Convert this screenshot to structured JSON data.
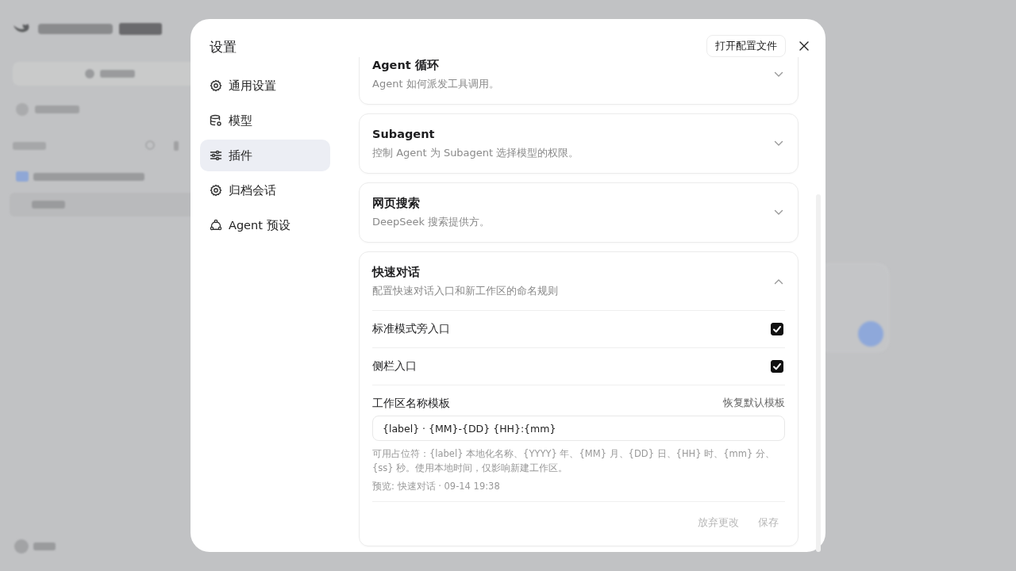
{
  "dialog": {
    "title": "设置",
    "open_config_button": "打开配置文件",
    "nav": [
      {
        "label": "通用设置",
        "selected": false
      },
      {
        "label": "模型",
        "selected": false
      },
      {
        "label": "插件",
        "selected": true
      },
      {
        "label": "归档会话",
        "selected": false
      },
      {
        "label": "Agent 预设",
        "selected": false
      }
    ],
    "sections": [
      {
        "title": "Agent 循环",
        "description": "Agent 如何派发工具调用。",
        "expanded": false
      },
      {
        "title": "Subagent",
        "description": "控制 Agent 为 Subagent 选择模型的权限。",
        "expanded": false
      },
      {
        "title": "网页搜索",
        "description": "DeepSeek 搜索提供方。",
        "expanded": false
      },
      {
        "title": "快速对话",
        "description": "配置快速对话入口和新工作区的命名规则",
        "expanded": true,
        "options": [
          {
            "label": "标准模式旁入口",
            "checked": true
          },
          {
            "label": "侧栏入口",
            "checked": true
          }
        ],
        "template": {
          "label": "工作区名称模板",
          "reset_link": "恢复默认模板",
          "value": "{label} · {MM}-{DD} {HH}:{mm}",
          "help": "可用占位符：{label} 本地化名称、{YYYY} 年、{MM} 月、{DD} 日、{HH} 时、{mm} 分、{ss} 秒。使用本地时间，仅影响新建工作区。",
          "preview": "预览: 快速对话 · 09-14 19:38"
        },
        "actions": [
          {
            "label": "放弃更改",
            "disabled": true
          },
          {
            "label": "保存",
            "disabled": true
          }
        ]
      }
    ]
  }
}
